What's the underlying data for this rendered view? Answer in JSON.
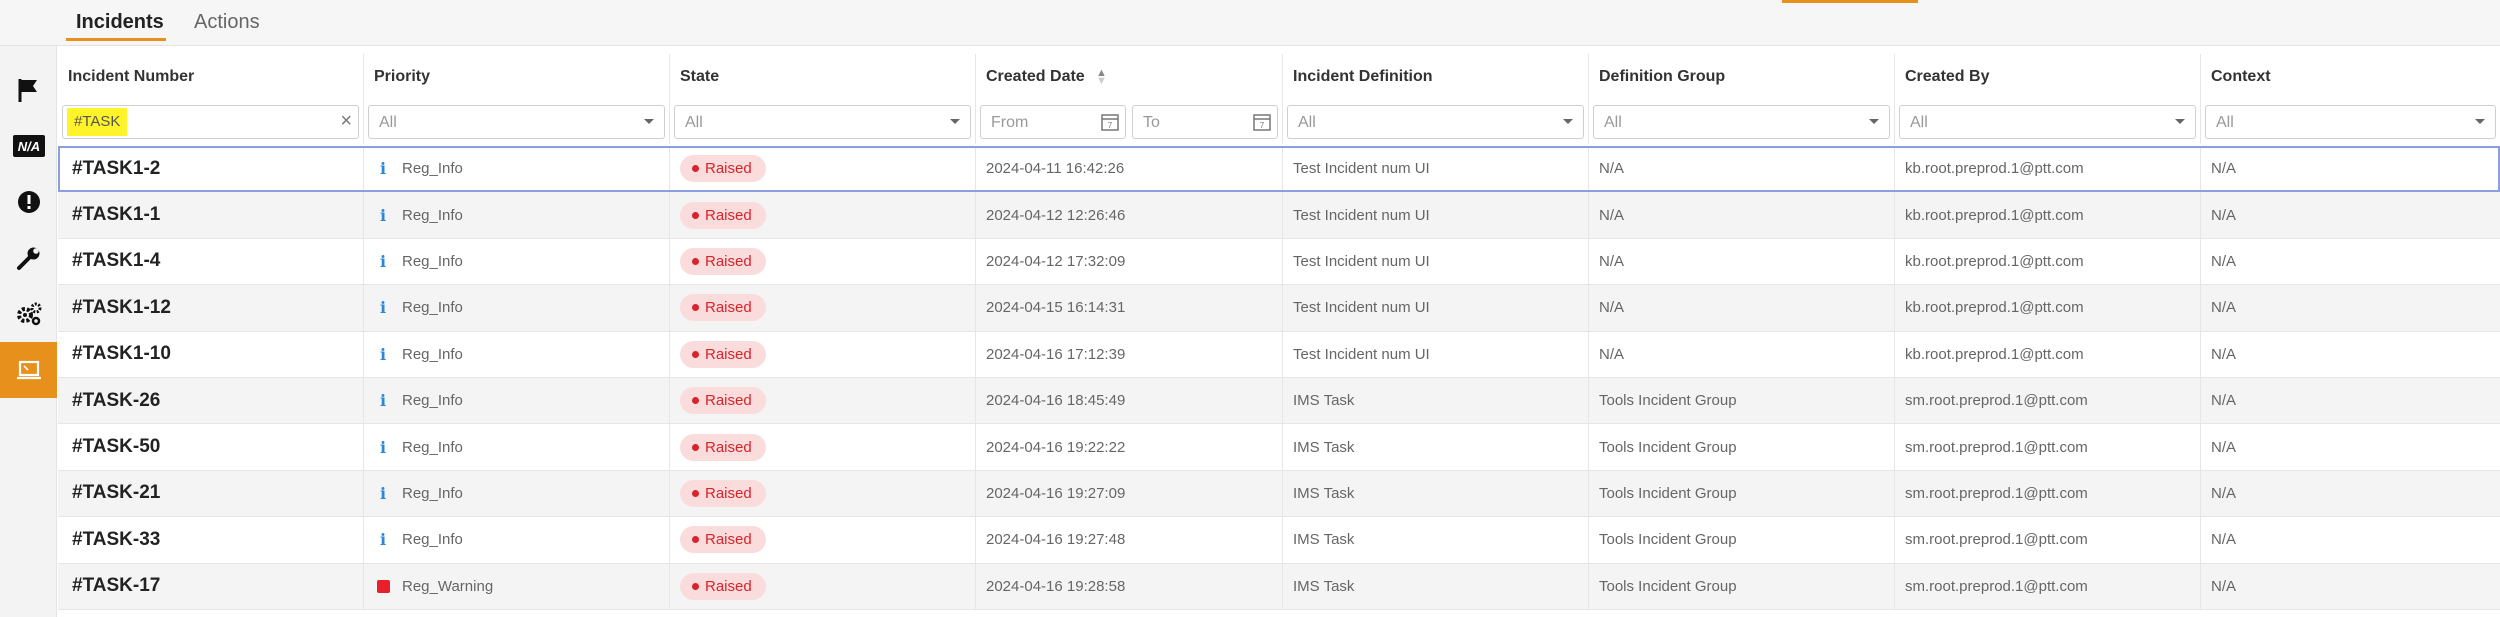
{
  "tabs": [
    {
      "label": "Incidents",
      "active": true
    },
    {
      "label": "Actions",
      "active": false
    }
  ],
  "sidebar": {
    "items": [
      {
        "icon": "flag-icon"
      },
      {
        "icon": "na-icon",
        "text": "N/A"
      },
      {
        "icon": "alert-circle-icon"
      },
      {
        "icon": "wrench-icon"
      },
      {
        "icon": "gears-icon"
      },
      {
        "icon": "monitor-icon",
        "active": true
      }
    ]
  },
  "columns": [
    "Incident Number",
    "Priority",
    "State",
    "Created Date",
    "Incident Definition",
    "Definition Group",
    "Created By",
    "Context"
  ],
  "filters": {
    "incident_number": "#TASK",
    "priority": "All",
    "state": "All",
    "date_from": "From",
    "date_to": "To",
    "definition": "All",
    "group": "All",
    "created_by": "All",
    "context": "All"
  },
  "rows": [
    {
      "number": "#TASK1-2",
      "priority": "Reg_Info",
      "priority_icon": "info-icon",
      "state": "Raised",
      "created": "2024-04-11 16:42:26",
      "definition": "Test Incident num UI",
      "group": "N/A",
      "by": "kb.root.preprod.1@ptt.com",
      "context": "N/A"
    },
    {
      "number": "#TASK1-1",
      "priority": "Reg_Info",
      "priority_icon": "info-icon",
      "state": "Raised",
      "created": "2024-04-12 12:26:46",
      "definition": "Test Incident num UI",
      "group": "N/A",
      "by": "kb.root.preprod.1@ptt.com",
      "context": "N/A"
    },
    {
      "number": "#TASK1-4",
      "priority": "Reg_Info",
      "priority_icon": "info-icon",
      "state": "Raised",
      "created": "2024-04-12 17:32:09",
      "definition": "Test Incident num UI",
      "group": "N/A",
      "by": "kb.root.preprod.1@ptt.com",
      "context": "N/A"
    },
    {
      "number": "#TASK1-12",
      "priority": "Reg_Info",
      "priority_icon": "info-icon",
      "state": "Raised",
      "created": "2024-04-15 16:14:31",
      "definition": "Test Incident num UI",
      "group": "N/A",
      "by": "kb.root.preprod.1@ptt.com",
      "context": "N/A"
    },
    {
      "number": "#TASK1-10",
      "priority": "Reg_Info",
      "priority_icon": "info-icon",
      "state": "Raised",
      "created": "2024-04-16 17:12:39",
      "definition": "Test Incident num UI",
      "group": "N/A",
      "by": "kb.root.preprod.1@ptt.com",
      "context": "N/A"
    },
    {
      "number": "#TASK-26",
      "priority": "Reg_Info",
      "priority_icon": "info-icon",
      "state": "Raised",
      "created": "2024-04-16 18:45:49",
      "definition": "IMS Task",
      "group": "Tools Incident Group",
      "by": "sm.root.preprod.1@ptt.com",
      "context": "N/A"
    },
    {
      "number": "#TASK-50",
      "priority": "Reg_Info",
      "priority_icon": "info-icon",
      "state": "Raised",
      "created": "2024-04-16 19:22:22",
      "definition": "IMS Task",
      "group": "Tools Incident Group",
      "by": "sm.root.preprod.1@ptt.com",
      "context": "N/A"
    },
    {
      "number": "#TASK-21",
      "priority": "Reg_Info",
      "priority_icon": "info-icon",
      "state": "Raised",
      "created": "2024-04-16 19:27:09",
      "definition": "IMS Task",
      "group": "Tools Incident Group",
      "by": "sm.root.preprod.1@ptt.com",
      "context": "N/A"
    },
    {
      "number": "#TASK-33",
      "priority": "Reg_Info",
      "priority_icon": "info-icon",
      "state": "Raised",
      "created": "2024-04-16 19:27:48",
      "definition": "IMS Task",
      "group": "Tools Incident Group",
      "by": "sm.root.preprod.1@ptt.com",
      "context": "N/A"
    },
    {
      "number": "#TASK-17",
      "priority": "Reg_Warning",
      "priority_icon": "warning-square-icon",
      "state": "Raised",
      "created": "2024-04-16 19:28:58",
      "definition": "IMS Task",
      "group": "Tools Incident Group",
      "by": "sm.root.preprod.1@ptt.com",
      "context": "N/A"
    }
  ],
  "colors": {
    "accent": "#e8901c",
    "raised_bg": "#fbdcdc",
    "raised_text": "#d8232a",
    "info_icon": "#2e86d6",
    "warning_icon": "#e8202a",
    "filter_highlight": "#fff32a"
  }
}
